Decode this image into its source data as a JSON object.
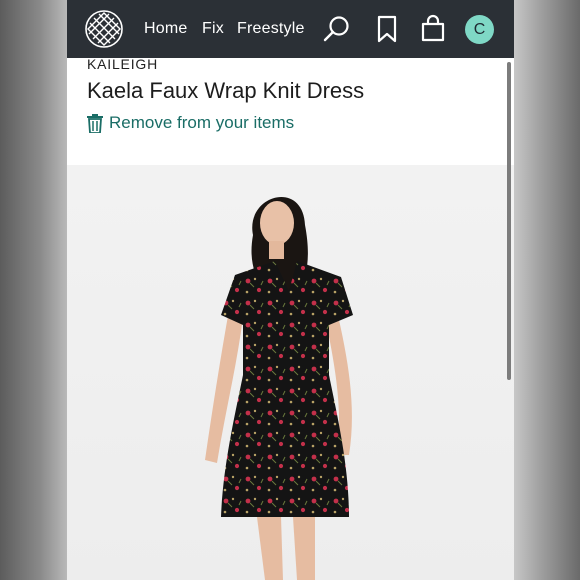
{
  "navbar": {
    "links": [
      {
        "label": "Home"
      },
      {
        "label": "Fix"
      },
      {
        "label": "Freestyle"
      }
    ],
    "icons": [
      "stitch-fix-logo-icon",
      "search-icon",
      "bookmark-icon",
      "shopping-bag-icon"
    ],
    "avatar_initial": "C",
    "colors": {
      "bar": "#2b3036",
      "avatar": "#7fd8c6",
      "accent": "#1a6d66"
    }
  },
  "product": {
    "brand": "KAILEIGH",
    "title": "Kaela Faux Wrap Knit Dress",
    "remove_label": "Remove from your items",
    "image_alt": "model-wearing-black-floral-wrap-dress"
  }
}
